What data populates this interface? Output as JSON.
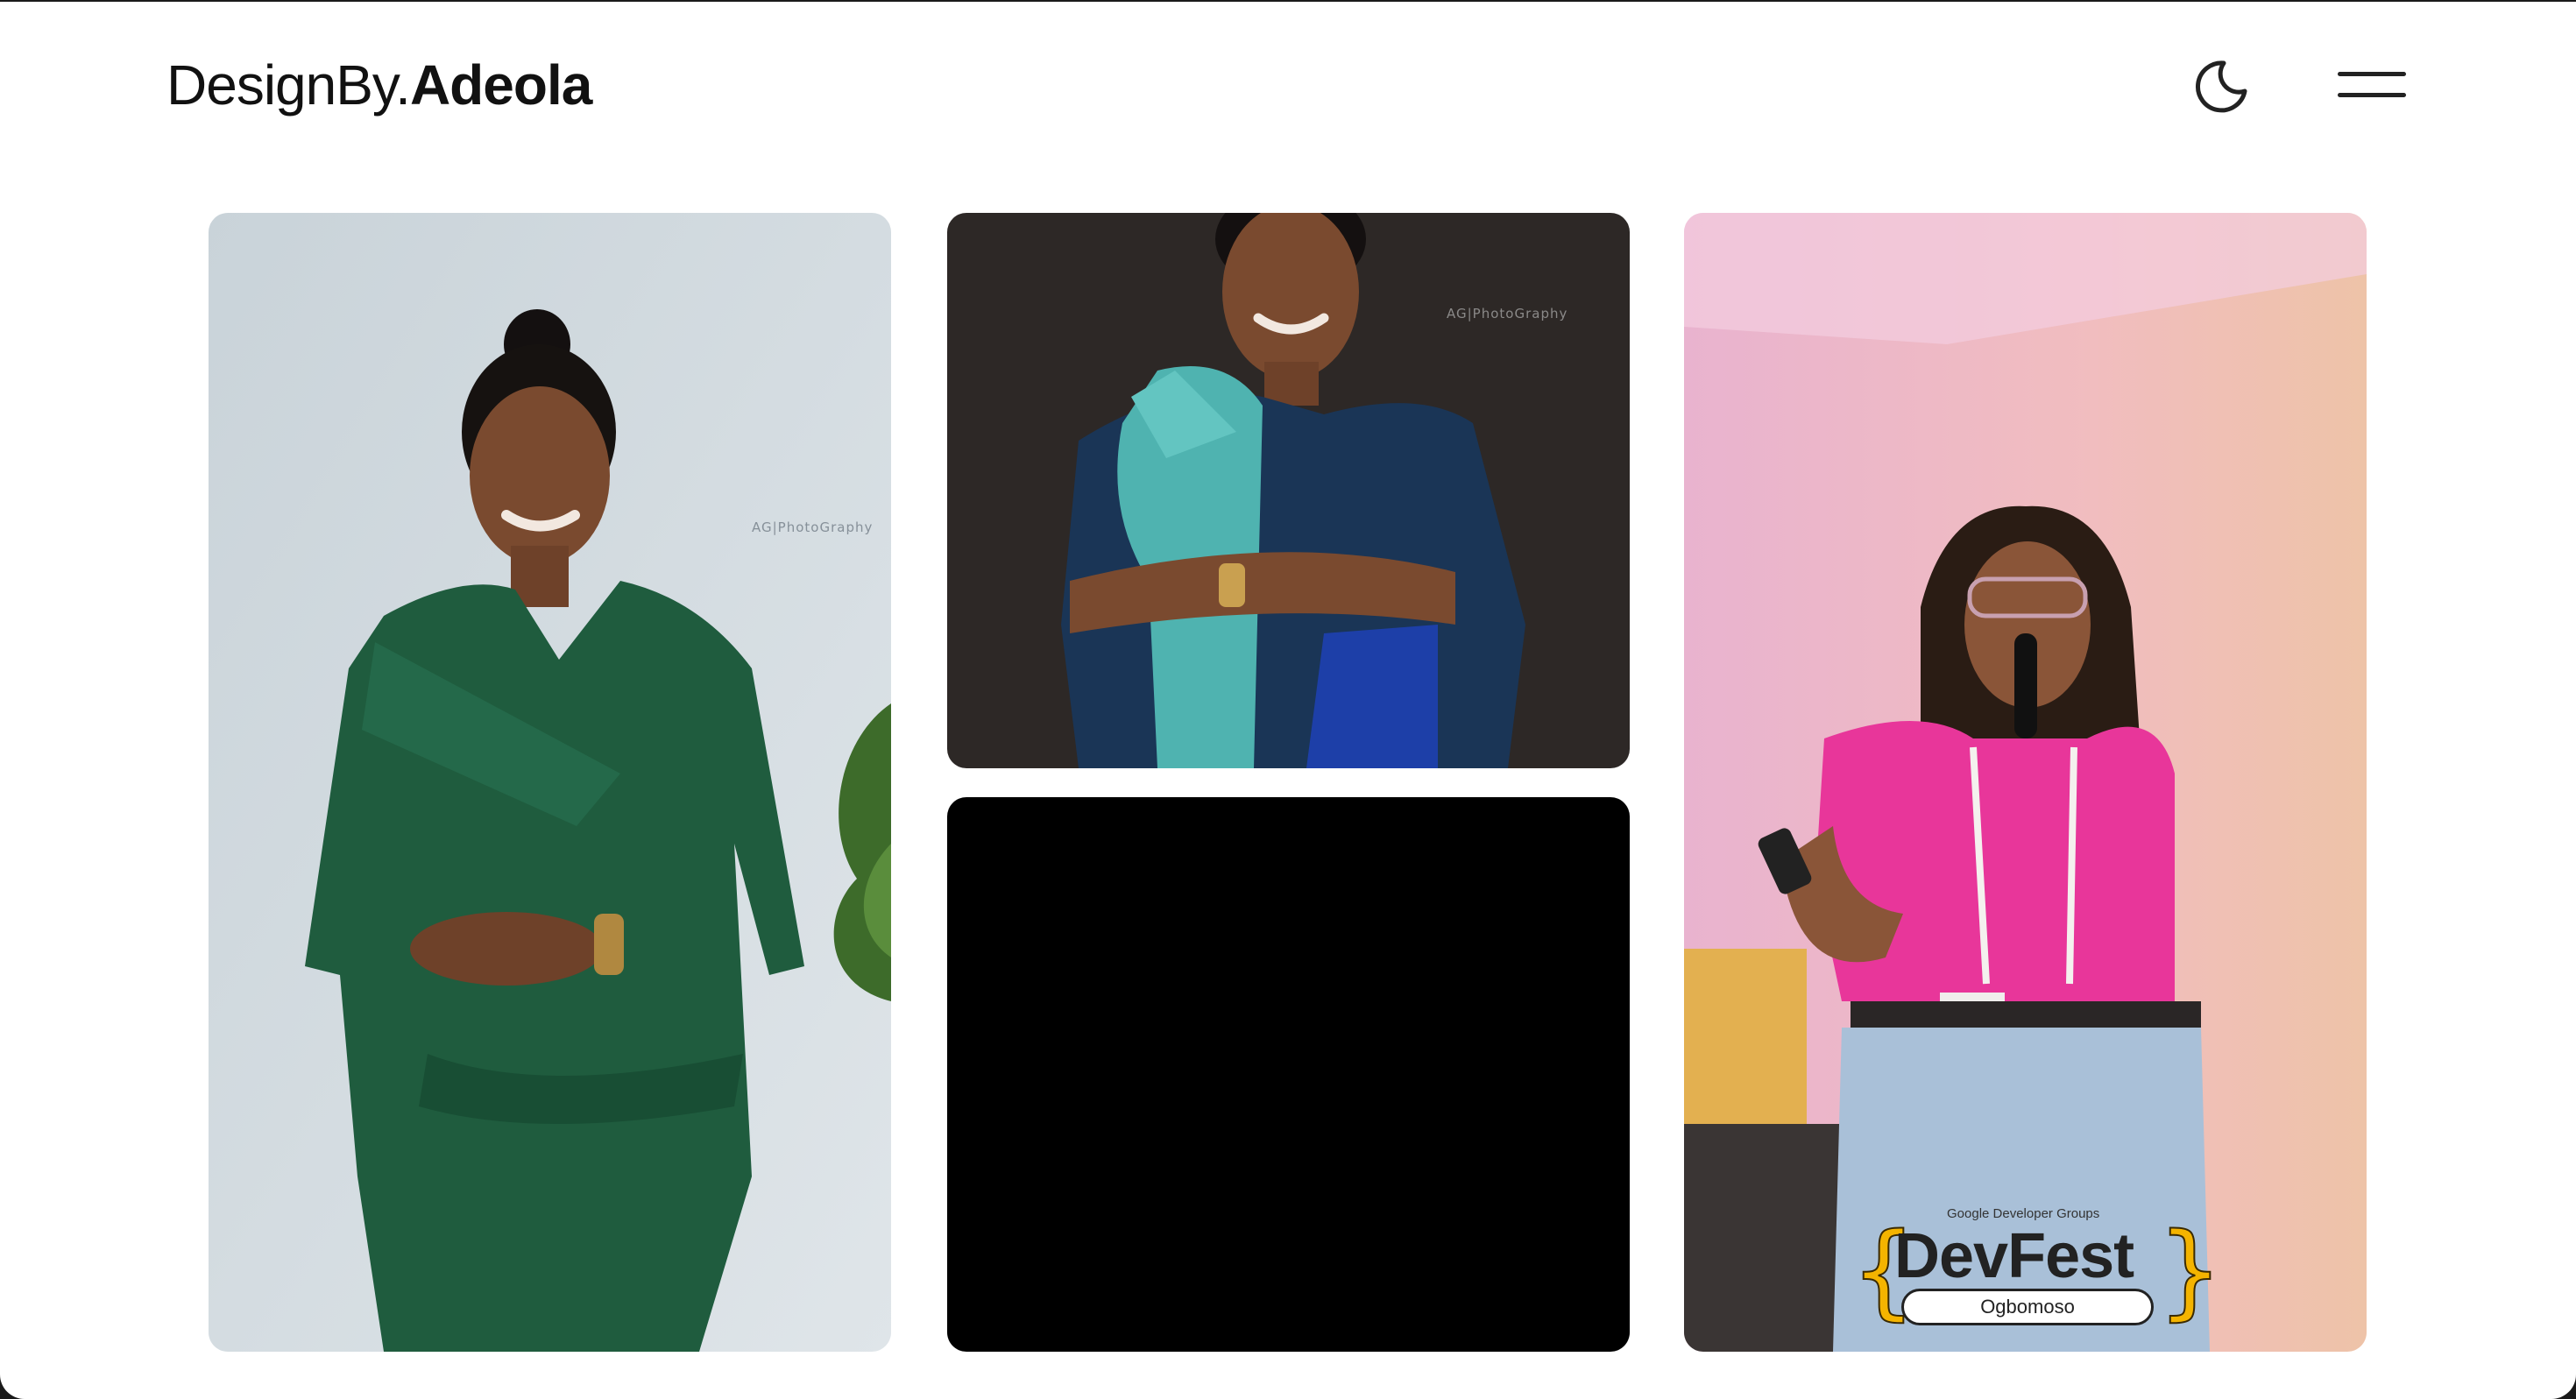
{
  "header": {
    "logo_prefix": "DesignBy.",
    "logo_name": "Adeola",
    "theme_icon": "moon-icon",
    "menu_icon": "hamburger-menu-icon"
  },
  "gallery": {
    "photo_1": {
      "watermark": "AG|PhotoGraphy"
    },
    "photo_2": {
      "watermark": "AG|PhotoGraphy"
    },
    "photo_3": {},
    "photo_4": {
      "badge_group": "Google Developer Groups",
      "badge_title": "DevFest",
      "badge_location": "Ogbomoso"
    }
  },
  "colors": {
    "background": "#ffffff",
    "text": "#111111",
    "devfest_accent": "#f4b400"
  }
}
